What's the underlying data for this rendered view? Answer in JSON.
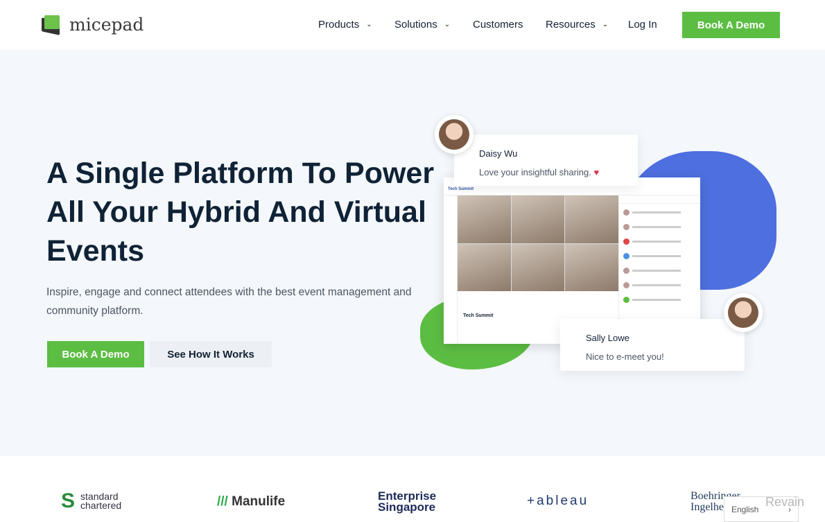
{
  "nav": {
    "brand": "micepad",
    "items": [
      {
        "label": "Products",
        "dropdown": true
      },
      {
        "label": "Solutions",
        "dropdown": true
      },
      {
        "label": "Customers",
        "dropdown": false
      },
      {
        "label": "Resources",
        "dropdown": true
      },
      {
        "label": "Log In",
        "dropdown": false
      }
    ],
    "cta": "Book A Demo"
  },
  "hero": {
    "title": "A Single Platform To Power All Your Hybrid And Virtual Events",
    "subtitle": "Inspire, engage and connect attendees with the best event management and community platform.",
    "primary_button": "Book A Demo",
    "secondary_button": "See How It Works"
  },
  "mockup": {
    "app_title": "Tech Summit",
    "event_title": "Tech Summit",
    "cards": [
      {
        "name": "Daisy Wu",
        "message": "Love your insightful sharing.",
        "icon": "heart-icon"
      },
      {
        "name": "Sally Lowe",
        "message": "Nice to e-meet you!"
      }
    ]
  },
  "logos": [
    "standard chartered",
    "Manulife",
    "Enterprise Singapore",
    "+ableau",
    "Boehringer Ingelheim"
  ],
  "language": {
    "selected": "English"
  },
  "watermark": "Revain",
  "colors": {
    "accent": "#5cbd43",
    "blue": "#4e6fe0",
    "heading": "#0f2236"
  }
}
